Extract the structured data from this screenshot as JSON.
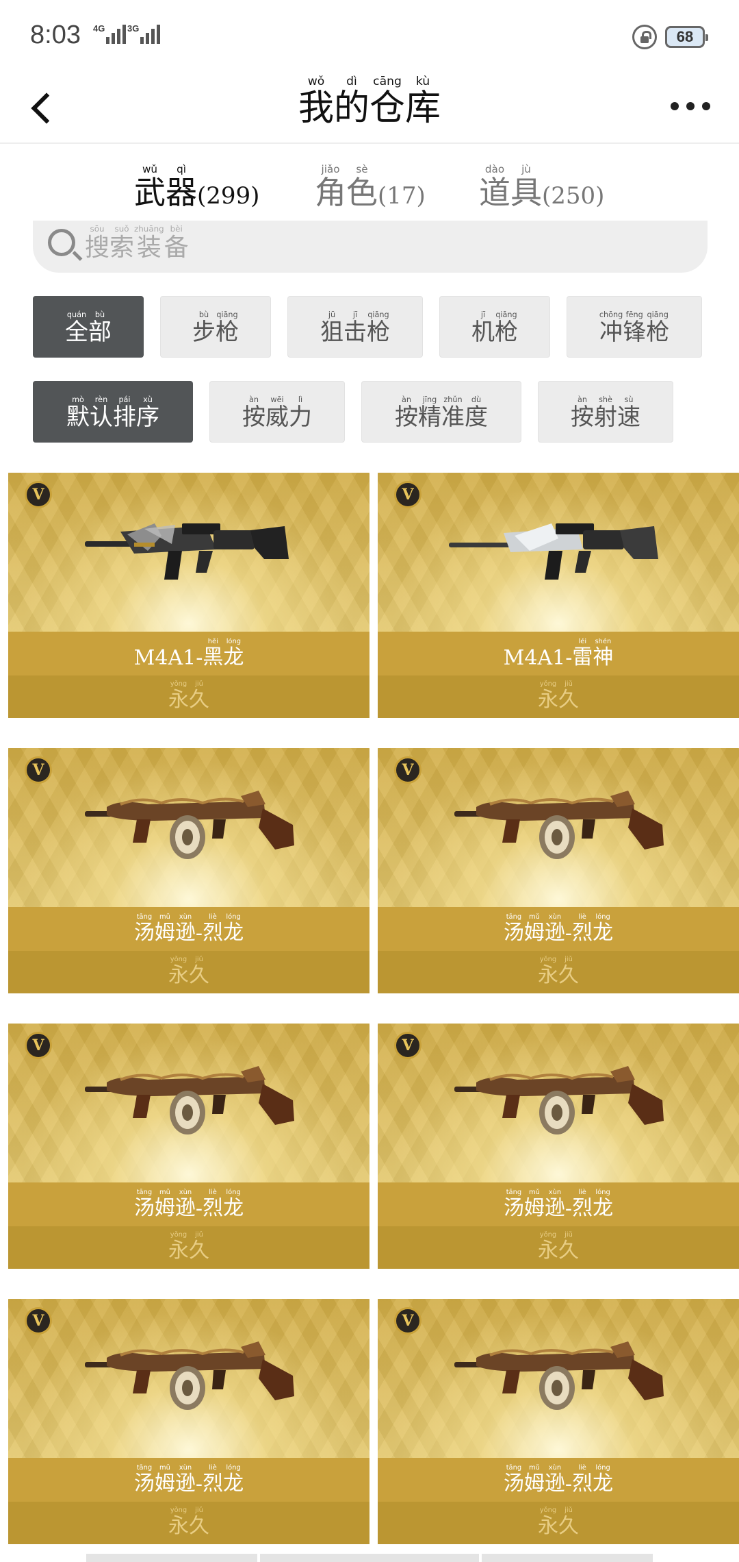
{
  "status_bar": {
    "time": "8:03",
    "network_1": "4G",
    "network_2": "3G",
    "battery": "68"
  },
  "header": {
    "title_chars": [
      {
        "char": "我",
        "pinyin": "wǒ"
      },
      {
        "char": "的",
        "pinyin": "dì"
      },
      {
        "char": "仓",
        "pinyin": "cāng"
      },
      {
        "char": "库",
        "pinyin": "kù"
      }
    ]
  },
  "tabs": [
    {
      "chars": [
        {
          "char": "武",
          "pinyin": "wǔ"
        },
        {
          "char": "器",
          "pinyin": "qì"
        }
      ],
      "count": "(299)",
      "active": true
    },
    {
      "chars": [
        {
          "char": "角",
          "pinyin": "jiǎo"
        },
        {
          "char": "色",
          "pinyin": "sè"
        }
      ],
      "count": "(17)",
      "active": false
    },
    {
      "chars": [
        {
          "char": "道",
          "pinyin": "dào"
        },
        {
          "char": "具",
          "pinyin": "jù"
        }
      ],
      "count": "(250)",
      "active": false
    }
  ],
  "search": {
    "placeholder_chars": [
      {
        "char": "搜",
        "pinyin": "sōu"
      },
      {
        "char": "索",
        "pinyin": "suǒ"
      },
      {
        "char": "装",
        "pinyin": "zhuāng"
      },
      {
        "char": "备",
        "pinyin": "bèi"
      }
    ]
  },
  "categories": [
    {
      "chars": [
        {
          "char": "全",
          "pinyin": "quán"
        },
        {
          "char": "部",
          "pinyin": "bù"
        }
      ],
      "active": true
    },
    {
      "chars": [
        {
          "char": "步",
          "pinyin": "bù"
        },
        {
          "char": "枪",
          "pinyin": "qiāng"
        }
      ],
      "active": false
    },
    {
      "chars": [
        {
          "char": "狙",
          "pinyin": "jū"
        },
        {
          "char": "击",
          "pinyin": "jī"
        },
        {
          "char": "枪",
          "pinyin": "qiāng"
        }
      ],
      "active": false
    },
    {
      "chars": [
        {
          "char": "机",
          "pinyin": "jī"
        },
        {
          "char": "枪",
          "pinyin": "qiāng"
        }
      ],
      "active": false
    },
    {
      "chars": [
        {
          "char": "冲",
          "pinyin": "chōng"
        },
        {
          "char": "锋",
          "pinyin": "fēng"
        },
        {
          "char": "枪",
          "pinyin": "qiāng"
        }
      ],
      "active": false
    }
  ],
  "sorts": [
    {
      "chars": [
        {
          "char": "默",
          "pinyin": "mò"
        },
        {
          "char": "认",
          "pinyin": "rèn"
        },
        {
          "char": "排",
          "pinyin": "pái"
        },
        {
          "char": "序",
          "pinyin": "xù"
        }
      ],
      "active": true
    },
    {
      "chars": [
        {
          "char": "按",
          "pinyin": "àn"
        },
        {
          "char": "威",
          "pinyin": "wēi"
        },
        {
          "char": "力",
          "pinyin": "lì"
        }
      ],
      "active": false
    },
    {
      "chars": [
        {
          "char": "按",
          "pinyin": "àn"
        },
        {
          "char": "精",
          "pinyin": "jīng"
        },
        {
          "char": "准",
          "pinyin": "zhǔn"
        },
        {
          "char": "度",
          "pinyin": "dù"
        }
      ],
      "active": false
    },
    {
      "chars": [
        {
          "char": "按",
          "pinyin": "àn"
        },
        {
          "char": "射",
          "pinyin": "shè"
        },
        {
          "char": "速",
          "pinyin": "sù"
        }
      ],
      "active": false
    }
  ],
  "badge_label": "V",
  "items": [
    {
      "weapon": "rifle-black",
      "name_prefix": "M4A1-",
      "name_chars": [
        {
          "char": "黑",
          "pinyin": "hēi"
        },
        {
          "char": "龙",
          "pinyin": "lóng"
        }
      ],
      "duration_chars": [
        {
          "char": "永",
          "pinyin": "yǒng"
        },
        {
          "char": "久",
          "pinyin": "jiǔ"
        }
      ]
    },
    {
      "weapon": "rifle-silver",
      "name_prefix": "M4A1-",
      "name_chars": [
        {
          "char": "雷",
          "pinyin": "léi"
        },
        {
          "char": "神",
          "pinyin": "shén"
        }
      ],
      "duration_chars": [
        {
          "char": "永",
          "pinyin": "yǒng"
        },
        {
          "char": "久",
          "pinyin": "jiǔ"
        }
      ]
    },
    {
      "weapon": "tommy-gun",
      "name_prefix": "",
      "name_chars": [
        {
          "char": "汤",
          "pinyin": "tāng"
        },
        {
          "char": "姆",
          "pinyin": "mǔ"
        },
        {
          "char": "逊",
          "pinyin": "xùn"
        },
        {
          "char": "-",
          "pinyin": ""
        },
        {
          "char": "烈",
          "pinyin": "liè"
        },
        {
          "char": "龙",
          "pinyin": "lóng"
        }
      ],
      "duration_chars": [
        {
          "char": "永",
          "pinyin": "yǒng"
        },
        {
          "char": "久",
          "pinyin": "jiǔ"
        }
      ]
    },
    {
      "weapon": "tommy-gun",
      "name_prefix": "",
      "name_chars": [
        {
          "char": "汤",
          "pinyin": "tāng"
        },
        {
          "char": "姆",
          "pinyin": "mǔ"
        },
        {
          "char": "逊",
          "pinyin": "xùn"
        },
        {
          "char": "-",
          "pinyin": ""
        },
        {
          "char": "烈",
          "pinyin": "liè"
        },
        {
          "char": "龙",
          "pinyin": "lóng"
        }
      ],
      "duration_chars": [
        {
          "char": "永",
          "pinyin": "yǒng"
        },
        {
          "char": "久",
          "pinyin": "jiǔ"
        }
      ]
    },
    {
      "weapon": "tommy-gun",
      "name_prefix": "",
      "name_chars": [
        {
          "char": "汤",
          "pinyin": "tāng"
        },
        {
          "char": "姆",
          "pinyin": "mǔ"
        },
        {
          "char": "逊",
          "pinyin": "xùn"
        },
        {
          "char": "-",
          "pinyin": ""
        },
        {
          "char": "烈",
          "pinyin": "liè"
        },
        {
          "char": "龙",
          "pinyin": "lóng"
        }
      ],
      "duration_chars": [
        {
          "char": "永",
          "pinyin": "yǒng"
        },
        {
          "char": "久",
          "pinyin": "jiǔ"
        }
      ]
    },
    {
      "weapon": "tommy-gun",
      "name_prefix": "",
      "name_chars": [
        {
          "char": "汤",
          "pinyin": "tāng"
        },
        {
          "char": "姆",
          "pinyin": "mǔ"
        },
        {
          "char": "逊",
          "pinyin": "xùn"
        },
        {
          "char": "-",
          "pinyin": ""
        },
        {
          "char": "烈",
          "pinyin": "liè"
        },
        {
          "char": "龙",
          "pinyin": "lóng"
        }
      ],
      "duration_chars": [
        {
          "char": "永",
          "pinyin": "yǒng"
        },
        {
          "char": "久",
          "pinyin": "jiǔ"
        }
      ]
    },
    {
      "weapon": "tommy-gun",
      "name_prefix": "",
      "name_chars": [
        {
          "char": "汤",
          "pinyin": "tāng"
        },
        {
          "char": "姆",
          "pinyin": "mǔ"
        },
        {
          "char": "逊",
          "pinyin": "xùn"
        },
        {
          "char": "-",
          "pinyin": ""
        },
        {
          "char": "烈",
          "pinyin": "liè"
        },
        {
          "char": "龙",
          "pinyin": "lóng"
        }
      ],
      "duration_chars": [
        {
          "char": "永",
          "pinyin": "yǒng"
        },
        {
          "char": "久",
          "pinyin": "jiǔ"
        }
      ]
    },
    {
      "weapon": "tommy-gun",
      "name_prefix": "",
      "name_chars": [
        {
          "char": "汤",
          "pinyin": "tāng"
        },
        {
          "char": "姆",
          "pinyin": "mǔ"
        },
        {
          "char": "逊",
          "pinyin": "xùn"
        },
        {
          "char": "-",
          "pinyin": ""
        },
        {
          "char": "烈",
          "pinyin": "liè"
        },
        {
          "char": "龙",
          "pinyin": "lóng"
        }
      ],
      "duration_chars": [
        {
          "char": "永",
          "pinyin": "yǒng"
        },
        {
          "char": "久",
          "pinyin": "jiǔ"
        }
      ]
    }
  ]
}
